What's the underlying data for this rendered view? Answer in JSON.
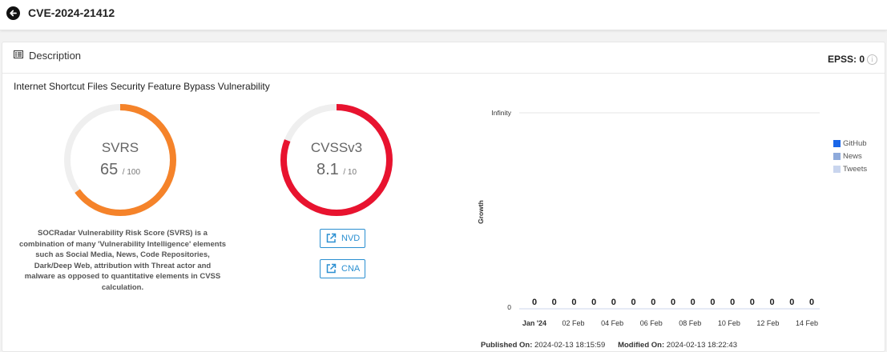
{
  "header": {
    "title": "CVE-2024-21412",
    "back_icon": "arrow-left-circle-icon"
  },
  "card": {
    "section_label": "Description",
    "epss_label": "EPSS: 0",
    "vuln_title": "Internet Shortcut Files Security Feature Bypass Vulnerability"
  },
  "svrs": {
    "name": "SVRS",
    "score": "65",
    "denom": "/ 100",
    "fraction": 0.65,
    "color": "#f5832a",
    "description": "SOCRadar Vulnerability Risk Score (SVRS) is a combination of many 'Vulnerability Intelligence' elements such as Social Media, News, Code Repositories, Dark/Deep Web, attribution with Threat actor and malware as opposed to quantitative elements in CVSS calculation."
  },
  "cvss": {
    "name": "CVSSv3",
    "score": "8.1",
    "denom": "/ 10",
    "fraction": 0.81,
    "color": "#e8132f"
  },
  "links": {
    "nvd": "NVD",
    "cna": "CNA"
  },
  "chart_data": {
    "type": "line",
    "ylabel": "Growth",
    "y_ticks": [
      "Infinity",
      "0"
    ],
    "x_ticks": [
      "Jan '24",
      "02 Feb",
      "04 Feb",
      "06 Feb",
      "08 Feb",
      "10 Feb",
      "12 Feb",
      "14 Feb"
    ],
    "point_labels": [
      "0",
      "0",
      "0",
      "0",
      "0",
      "0",
      "0",
      "0",
      "0",
      "0",
      "0",
      "0",
      "0",
      "0",
      "0"
    ],
    "series": [
      {
        "name": "GitHub",
        "color": "#1a66e8"
      },
      {
        "name": "News",
        "color": "#8eaadb"
      },
      {
        "name": "Tweets",
        "color": "#c9d5ee"
      }
    ],
    "legend_position": "right"
  },
  "dates": {
    "published_label": "Published On:",
    "published_value": "2024-02-13 18:15:59",
    "modified_label": "Modified On:",
    "modified_value": "2024-02-13 18:22:43"
  }
}
